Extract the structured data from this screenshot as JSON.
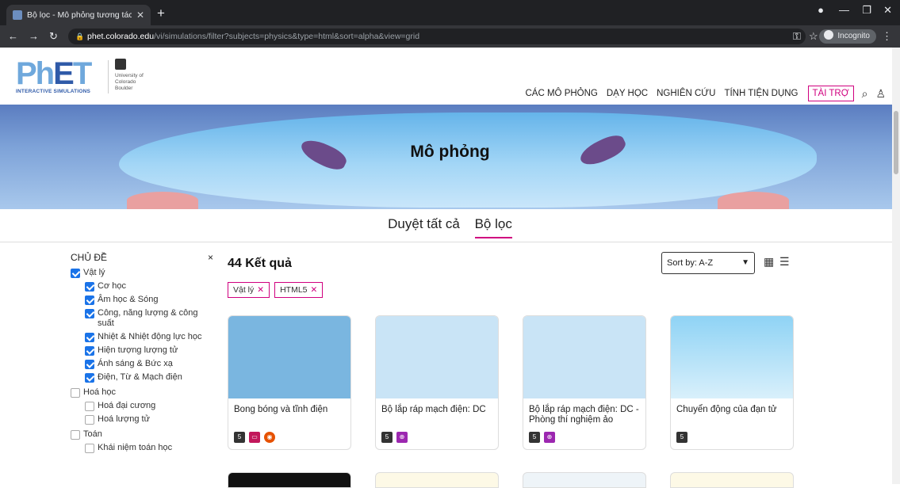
{
  "browser": {
    "tab_title": "Bộ lọc - Mô phỏng tương tác Ph",
    "url_host": "phet.colorado.edu",
    "url_path": "/vi/simulations/filter?subjects=physics&type=html&sort=alpha&view=grid",
    "incognito": "Incognito"
  },
  "header": {
    "logo_text": "PhET",
    "logo_sub": "INTERACTIVE SIMULATIONS",
    "cu_text": "University of Colorado Boulder",
    "menu": [
      "CÁC MÔ PHỎNG",
      "DẠY HỌC",
      "NGHIÊN CỨU",
      "TÍNH TIỆN DỤNG"
    ],
    "donate": "TÀI TRỢ"
  },
  "banner": {
    "title": "Mô phỏng"
  },
  "tabs": [
    "Duyệt tất cả",
    "Bộ lọc"
  ],
  "sidebar": {
    "heading": "CHỦ ĐỀ",
    "close": "×",
    "physics": "Vật lý",
    "physics_items": [
      "Cơ học",
      "Âm học & Sóng",
      "Công, năng lượng & công suất",
      "Nhiệt & Nhiệt động lực học",
      "Hiện tượng lượng tử",
      "Ánh sáng & Bức xạ",
      "Điện, Từ & Mạch điện"
    ],
    "chemistry": "Hoá học",
    "chemistry_items": [
      "Hoá đại cương",
      "Hoá lượng tử"
    ],
    "math": "Toán",
    "math_items": [
      "Khái niệm toán học"
    ]
  },
  "results": {
    "count_label": "44 Kết quả",
    "chips": [
      "Vật lý",
      "HTML5"
    ],
    "sort_label": "Sort by: A-Z"
  },
  "cards": [
    {
      "title": "Bong bóng và tĩnh điện"
    },
    {
      "title": "Bộ lắp ráp mạch điện: DC"
    },
    {
      "title": "Bộ lắp ráp mạch điện: DC - Phòng thí nghiệm ảo"
    },
    {
      "title": "Chuyển động của đạn tử"
    }
  ],
  "colors": {
    "accent": "#d0007f",
    "checkbox": "#1a73e8",
    "logo_blue": "#6fa8dc"
  }
}
